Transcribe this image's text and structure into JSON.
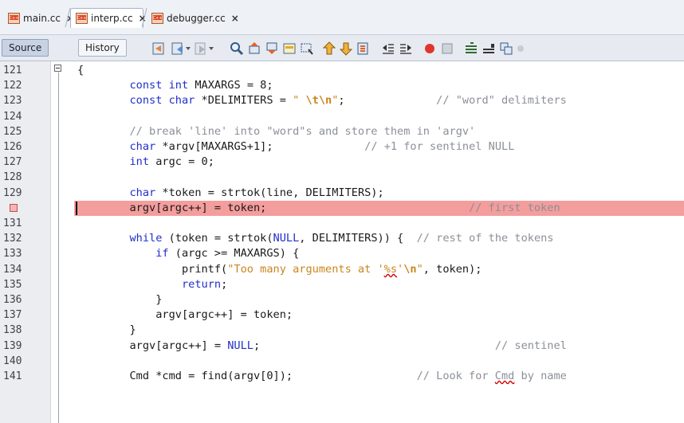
{
  "tabs": [
    {
      "label": "main.cc",
      "close": "×",
      "active": false
    },
    {
      "label": "interp.cc",
      "close": "×",
      "active": true
    },
    {
      "label": "debugger.cc",
      "close": "×",
      "active": false
    }
  ],
  "toolbar": {
    "source_label": "Source",
    "history_label": "History",
    "icons": [
      "last-edit-icon",
      "back-icon",
      "forward-icon",
      "find-selection-icon",
      "find-previous-icon",
      "find-next-icon",
      "toggle-highlight-icon",
      "toggle-rect-selection-icon",
      "previous-bookmark-icon",
      "next-bookmark-icon",
      "toggle-bookmark-icon",
      "shift-left-icon",
      "shift-right-icon",
      "start-macro-icon",
      "stop-macro-icon",
      "comment-icon",
      "uncomment-icon",
      "diff-icon"
    ]
  },
  "editor": {
    "breakpoint_line_number": 130,
    "lines": [
      {
        "num": "121",
        "segs": [
          [
            "",
            "{"
          ]
        ]
      },
      {
        "num": "122",
        "segs": [
          [
            "",
            "        "
          ],
          [
            "kw",
            "const int"
          ],
          [
            "",
            " MAXARGS = 8;"
          ]
        ]
      },
      {
        "num": "123",
        "segs": [
          [
            "",
            "        "
          ],
          [
            "kw",
            "const char"
          ],
          [
            "",
            " *DELIMITERS = "
          ],
          [
            "st",
            "\" "
          ],
          [
            "esc",
            "\\t\\n"
          ],
          [
            "st",
            "\""
          ],
          [
            "",
            ";              "
          ],
          [
            "cm",
            "// \"word\" delimiters"
          ]
        ]
      },
      {
        "num": "124",
        "segs": [
          [
            "",
            ""
          ]
        ]
      },
      {
        "num": "125",
        "segs": [
          [
            "",
            "        "
          ],
          [
            "cm",
            "// break 'line' into \"word\"s and store them in 'argv'"
          ]
        ]
      },
      {
        "num": "126",
        "segs": [
          [
            "",
            "        "
          ],
          [
            "kw",
            "char"
          ],
          [
            "",
            " *argv[MAXARGS+1];              "
          ],
          [
            "cm",
            "// +1 for sentinel NULL"
          ]
        ]
      },
      {
        "num": "127",
        "segs": [
          [
            "",
            "        "
          ],
          [
            "kw",
            "int"
          ],
          [
            "",
            " argc = 0;"
          ]
        ]
      },
      {
        "num": "128",
        "segs": [
          [
            "",
            ""
          ]
        ]
      },
      {
        "num": "129",
        "segs": [
          [
            "",
            "        "
          ],
          [
            "kw",
            "char"
          ],
          [
            "",
            " *token = strtok(line, DELIMITERS);"
          ]
        ]
      },
      {
        "num": "",
        "segs": [
          [
            "",
            "        argv[argc++] = token;                               "
          ],
          [
            "cm",
            "// first token"
          ]
        ],
        "breakpoint": true
      },
      {
        "num": "131",
        "segs": [
          [
            "",
            ""
          ]
        ]
      },
      {
        "num": "132",
        "segs": [
          [
            "",
            "        "
          ],
          [
            "kw",
            "while"
          ],
          [
            "",
            " (token = strtok("
          ],
          [
            "nl",
            "NULL"
          ],
          [
            "",
            ", DELIMITERS)) {  "
          ],
          [
            "cm",
            "// rest of the tokens"
          ]
        ]
      },
      {
        "num": "133",
        "segs": [
          [
            "",
            "            "
          ],
          [
            "kw",
            "if"
          ],
          [
            "",
            " (argc >= MAXARGS) {"
          ]
        ]
      },
      {
        "num": "134",
        "segs": [
          [
            "",
            "                printf("
          ],
          [
            "st",
            "\"Too many arguments at '"
          ],
          [
            "sqst",
            "%s"
          ],
          [
            "st",
            "'"
          ],
          [
            "esc",
            "\\n"
          ],
          [
            "st",
            "\""
          ],
          [
            "",
            ", token);"
          ]
        ]
      },
      {
        "num": "135",
        "segs": [
          [
            "",
            "                "
          ],
          [
            "kw",
            "return"
          ],
          [
            "",
            ";"
          ]
        ]
      },
      {
        "num": "136",
        "segs": [
          [
            "",
            "            }"
          ]
        ]
      },
      {
        "num": "137",
        "segs": [
          [
            "",
            "            argv[argc++] = token;"
          ]
        ]
      },
      {
        "num": "138",
        "segs": [
          [
            "",
            "        }"
          ]
        ]
      },
      {
        "num": "139",
        "segs": [
          [
            "",
            "        argv[argc++] = "
          ],
          [
            "nl",
            "NULL"
          ],
          [
            "",
            ";                                    "
          ],
          [
            "cm",
            "// sentinel"
          ]
        ]
      },
      {
        "num": "140",
        "segs": [
          [
            "",
            ""
          ]
        ]
      },
      {
        "num": "141",
        "segs": [
          [
            "",
            "        Cmd *cmd = find(argv[0]);                   "
          ],
          [
            "cm",
            "// Look for "
          ],
          [
            "sqcm",
            "Cmd"
          ],
          [
            "cm",
            " by name"
          ]
        ]
      }
    ]
  },
  "colors": {
    "breakpoint_band": "#f49d9d",
    "keyword": "#1f2fc8",
    "comment": "#8b8f97",
    "string": "#c9861c"
  }
}
